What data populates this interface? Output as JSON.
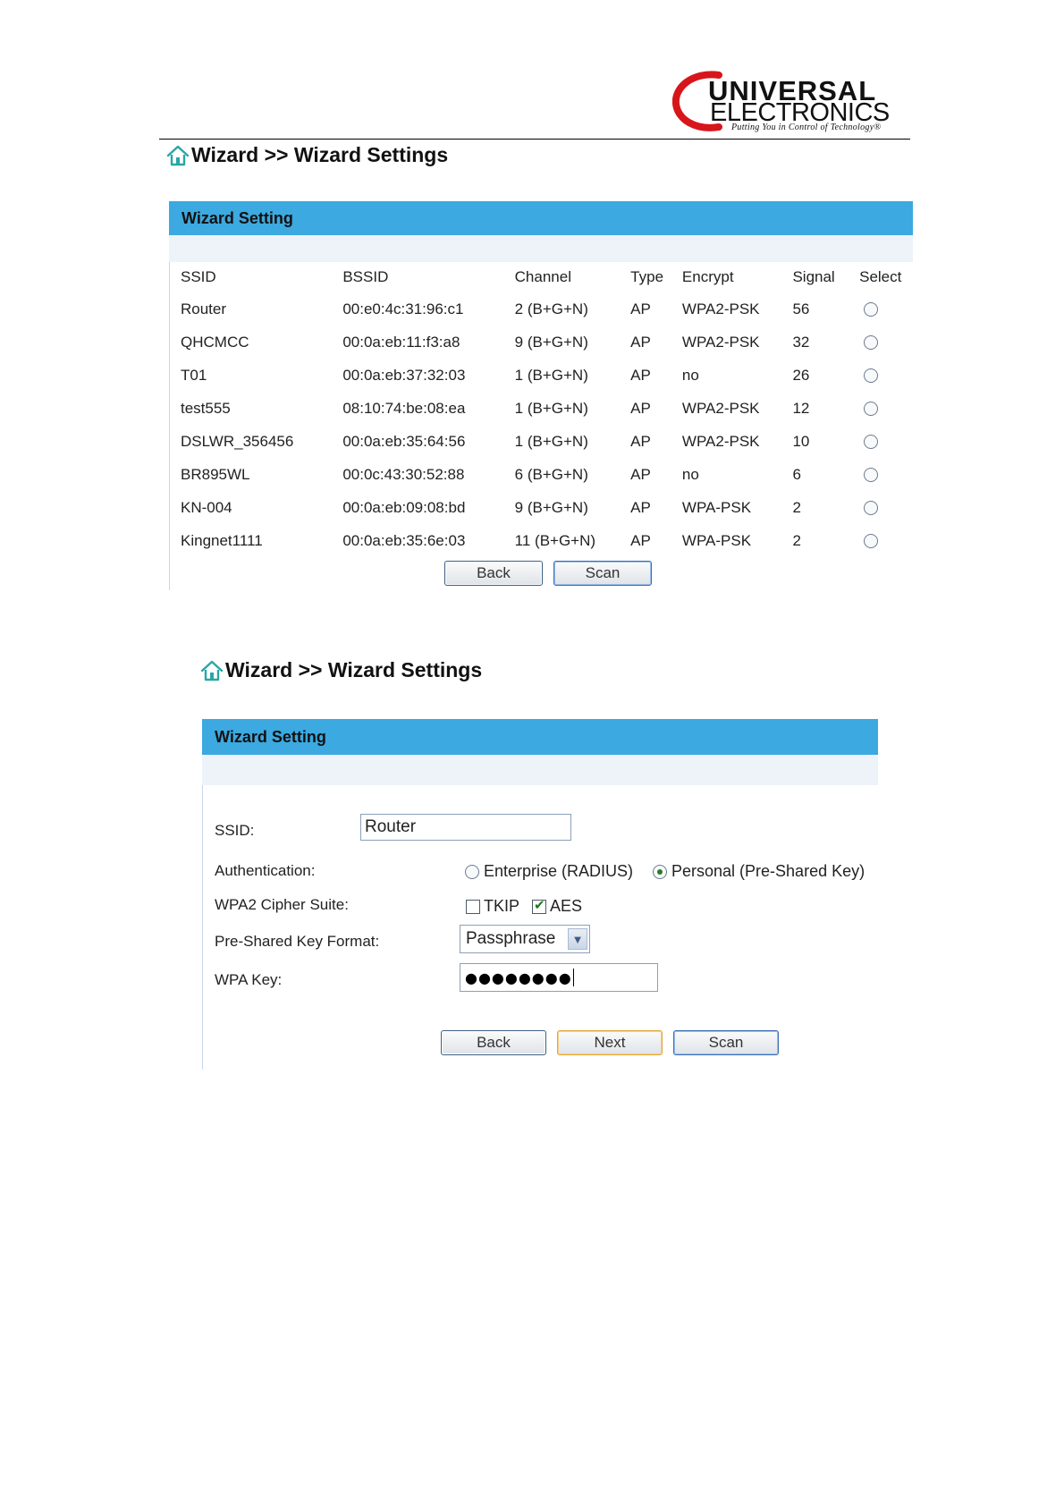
{
  "logo": {
    "main": "UNIVERSAL",
    "sub": "ELECTRONICS",
    "tagline": "Putting You in Control of Technology®"
  },
  "screen1": {
    "title": "Wizard >> Wizard Settings",
    "panel_title": "Wizard Setting",
    "columns": [
      "SSID",
      "BSSID",
      "Channel",
      "Type",
      "Encrypt",
      "Signal",
      "Select"
    ],
    "rows": [
      {
        "ssid": "Router",
        "bssid": "00:e0:4c:31:96:c1",
        "channel": "2 (B+G+N)",
        "type": "AP",
        "encrypt": "WPA2-PSK",
        "signal": "56"
      },
      {
        "ssid": "QHCMCC",
        "bssid": "00:0a:eb:11:f3:a8",
        "channel": "9 (B+G+N)",
        "type": "AP",
        "encrypt": "WPA2-PSK",
        "signal": "32"
      },
      {
        "ssid": "T01",
        "bssid": "00:0a:eb:37:32:03",
        "channel": "1 (B+G+N)",
        "type": "AP",
        "encrypt": "no",
        "signal": "26"
      },
      {
        "ssid": "test555",
        "bssid": "08:10:74:be:08:ea",
        "channel": "1 (B+G+N)",
        "type": "AP",
        "encrypt": "WPA2-PSK",
        "signal": "12"
      },
      {
        "ssid": "DSLWR_356456",
        "bssid": "00:0a:eb:35:64:56",
        "channel": "1 (B+G+N)",
        "type": "AP",
        "encrypt": "WPA2-PSK",
        "signal": "10"
      },
      {
        "ssid": "BR895WL",
        "bssid": "00:0c:43:30:52:88",
        "channel": "6 (B+G+N)",
        "type": "AP",
        "encrypt": "no",
        "signal": "6"
      },
      {
        "ssid": "KN-004",
        "bssid": "00:0a:eb:09:08:bd",
        "channel": "9 (B+G+N)",
        "type": "AP",
        "encrypt": "WPA-PSK",
        "signal": "2"
      },
      {
        "ssid": "Kingnet1111",
        "bssid": "00:0a:eb:35:6e:03",
        "channel": "11 (B+G+N)",
        "type": "AP",
        "encrypt": "WPA-PSK",
        "signal": "2"
      }
    ],
    "back_label": "Back",
    "scan_label": "Scan"
  },
  "screen2": {
    "title": "Wizard >> Wizard Settings",
    "panel_title": "Wizard Setting",
    "ssid_label": "SSID:",
    "ssid_value": "Router",
    "auth_label": "Authentication:",
    "auth_enterprise": "Enterprise (RADIUS)",
    "auth_personal": "Personal (Pre-Shared Key)",
    "auth_selected": "personal",
    "cipher_label": "WPA2 Cipher Suite:",
    "cipher_tkip": "TKIP",
    "cipher_aes": "AES",
    "tkip_checked": false,
    "aes_checked": true,
    "psk_format_label": "Pre-Shared Key Format:",
    "psk_format_value": "Passphrase",
    "wpa_key_label": "WPA Key:",
    "wpa_key_masked": "●●●●●●●●",
    "back_label": "Back",
    "next_label": "Next",
    "scan_label": "Scan"
  },
  "colors": {
    "panel_header": "#3ca9e0",
    "panel_strip": "#eef3fa",
    "home_icon": "#2aa6a6",
    "logo_red": "#d7161b"
  },
  "icons": [
    "home-icon",
    "radio-button",
    "checkbox",
    "chevron-down-icon"
  ]
}
